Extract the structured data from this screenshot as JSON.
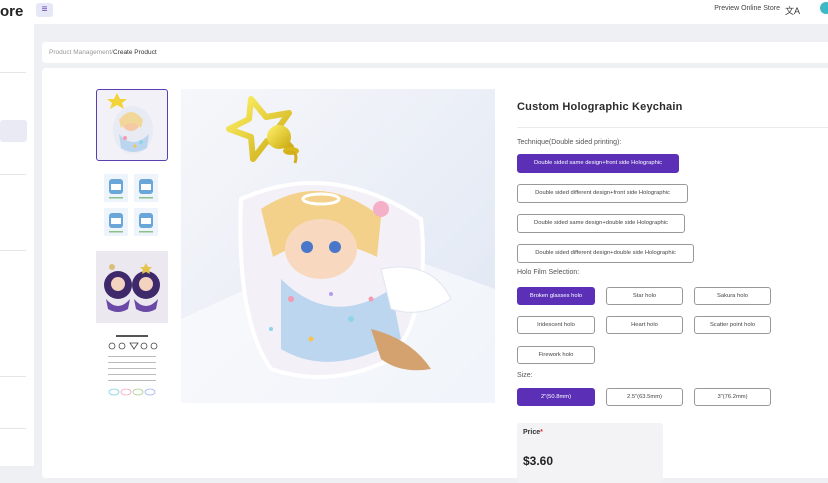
{
  "header": {
    "brand": "ore",
    "menu_icon": "≡",
    "preview_label": "Preview Online Store",
    "lang_icon": "文A"
  },
  "breadcrumb": {
    "parent": "Product Management",
    "sep": "/",
    "current": "Create Product"
  },
  "product": {
    "title": "Custom Holographic Keychain",
    "technique_label": "Technique(Double sided printing):",
    "techniques": [
      "Double sided same design+front side Holographic",
      "Double sided different design+front side Holographic",
      "Double sided same design+double side Holographic",
      "Double sided different design+double side Holographic"
    ],
    "holo_label": "Holo Film Selection:",
    "holo": [
      "Broken glasses holo",
      "Star holo",
      "Sakura holo",
      "Iridescent holo",
      "Heart holo",
      "Scatter point holo",
      "Firework holo"
    ],
    "size_label": "Size:",
    "sizes": [
      "2\"(50.8mm)",
      "2.5\"(63.5mm)",
      "3\"(76.2mm)"
    ],
    "price_label": "Price",
    "price_required": "*",
    "price": "$3.60"
  },
  "colors": {
    "accent": "#5b30b6",
    "teal": "#3cb8c6"
  }
}
